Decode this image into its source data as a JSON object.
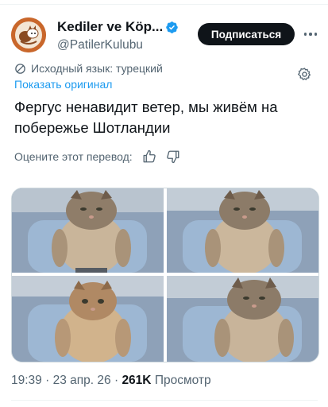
{
  "author": {
    "display_name": "Kediler ve Köp...",
    "handle": "@PatilerKulubu",
    "verified": true,
    "avatar_icon": "cat-dog-avatar-icon"
  },
  "actions": {
    "subscribe_label": "Подписаться",
    "more_icon": "more-dots-icon"
  },
  "translation": {
    "source_language": "Исходный язык: турецкий",
    "show_original": "Показать оригинал",
    "settings_icon": "gear-icon",
    "rate_prompt": "Оцените этот перевод:",
    "like_icon": "thumbs-up-icon",
    "dislike_icon": "thumbs-down-icon"
  },
  "tweet": {
    "text": "Фергус ненавидит ветер, мы живём на побережье Шотландии"
  },
  "media": {
    "photos": [
      "cat-photo-1",
      "cat-photo-2",
      "cat-photo-3",
      "cat-photo-4"
    ]
  },
  "meta": {
    "time": "19:39",
    "separator": "·",
    "date": "23 апр. 26",
    "views_count": "261K",
    "views_label": "Просмотр"
  },
  "colors": {
    "accent": "#1d9bf0",
    "text_primary": "#0f1419",
    "text_secondary": "#536471",
    "button_bg": "#0f1419"
  }
}
